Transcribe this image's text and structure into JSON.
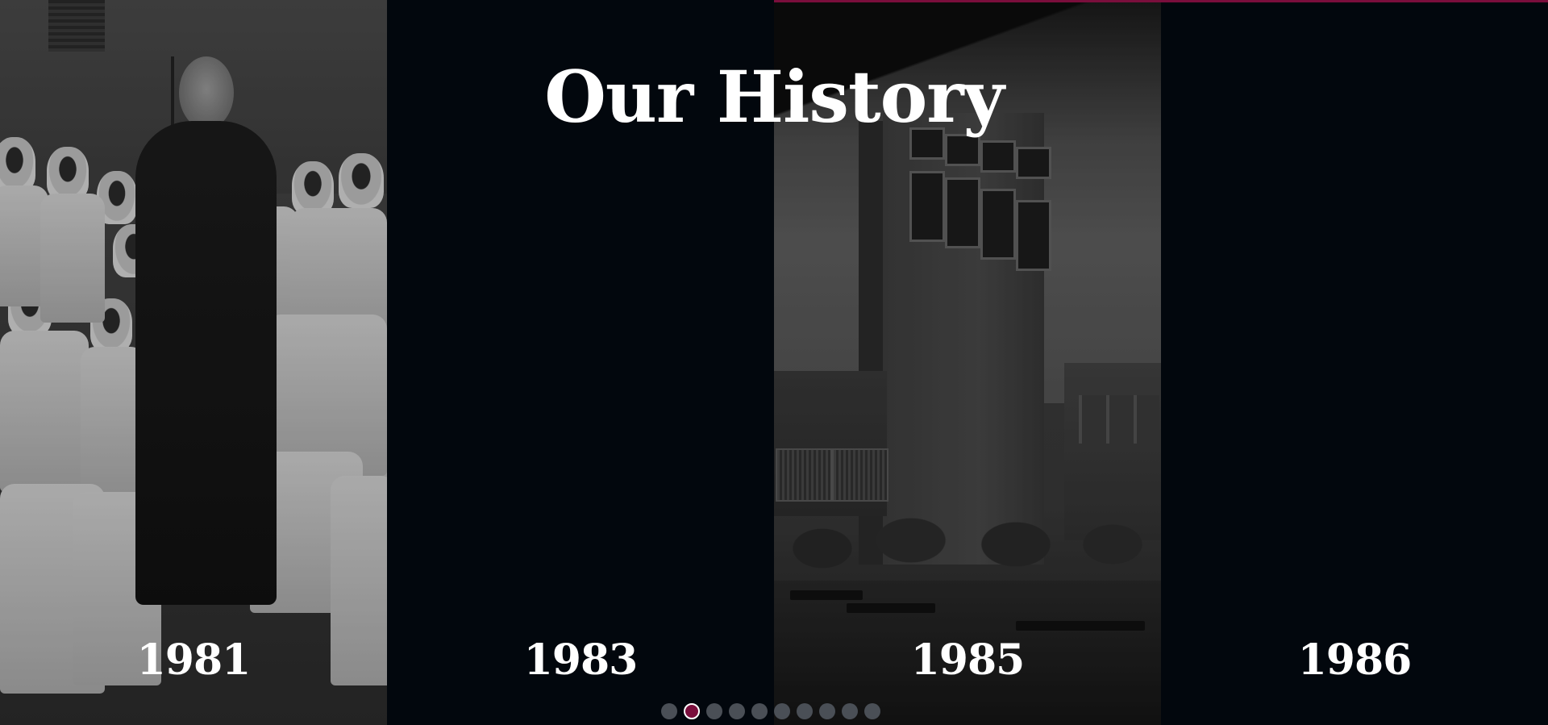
{
  "page": {
    "title": "Our History"
  },
  "timeline": [
    {
      "year": "1981",
      "image": "archival photo: nurses with dignitary"
    },
    {
      "year": "1983",
      "image": ""
    },
    {
      "year": "1985",
      "image": "archival photo: hospital building courtyard"
    },
    {
      "year": "1986",
      "image": ""
    }
  ],
  "pagination": {
    "total_dots": 10,
    "active_index": 1
  },
  "colors": {
    "background": "#02070d",
    "accent": "#7a0e3c",
    "text": "#ffffff",
    "dot_inactive": "#4a4f56"
  }
}
